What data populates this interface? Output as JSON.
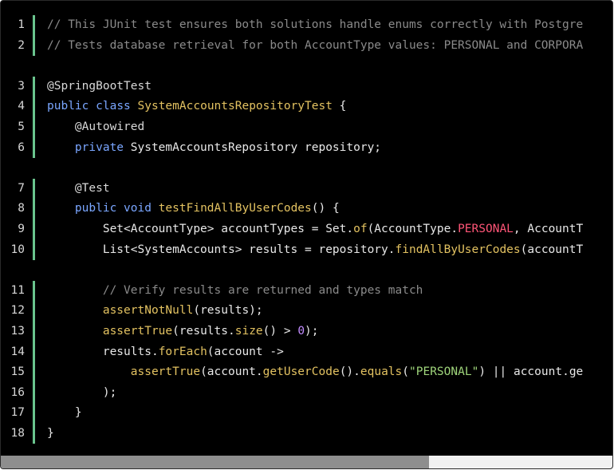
{
  "code_lines": [
    {
      "n": "1",
      "tokens": [
        [
          "com",
          "// This JUnit test ensures both solutions handle enums correctly with Postgre"
        ]
      ]
    },
    {
      "n": "2",
      "tokens": [
        [
          "com",
          "// Tests database retrieval for both AccountType values: PERSONAL and CORPORA"
        ]
      ]
    },
    {
      "n": "3",
      "tokens": [
        [
          "ann",
          "@SpringBootTest"
        ]
      ]
    },
    {
      "n": "4",
      "tokens": [
        [
          "kw",
          "public"
        ],
        [
          "",
          " "
        ],
        [
          "kw",
          "class"
        ],
        [
          "",
          " "
        ],
        [
          "cls",
          "SystemAccountsRepositoryTest"
        ],
        [
          "",
          " {"
        ]
      ]
    },
    {
      "n": "5",
      "tokens": [
        [
          "",
          "    "
        ],
        [
          "ann",
          "@Autowired"
        ]
      ]
    },
    {
      "n": "6",
      "tokens": [
        [
          "",
          "    "
        ],
        [
          "kw",
          "private"
        ],
        [
          "",
          " SystemAccountsRepository repository;"
        ]
      ]
    },
    {
      "n": "7",
      "tokens": [
        [
          "",
          "    "
        ],
        [
          "ann",
          "@Test"
        ]
      ]
    },
    {
      "n": "8",
      "tokens": [
        [
          "",
          "    "
        ],
        [
          "kw",
          "public"
        ],
        [
          "",
          " "
        ],
        [
          "kw",
          "void"
        ],
        [
          "",
          " "
        ],
        [
          "fn",
          "testFindAllByUserCodes"
        ],
        [
          "",
          "() {"
        ]
      ]
    },
    {
      "n": "9",
      "tokens": [
        [
          "",
          "        Set<AccountType> accountTypes = Set."
        ],
        [
          "fn",
          "of"
        ],
        [
          "",
          "(AccountType."
        ],
        [
          "enum",
          "PERSONAL"
        ],
        [
          "",
          ", AccountT"
        ]
      ]
    },
    {
      "n": "10",
      "tokens": [
        [
          "",
          "        List<SystemAccounts> results = repository."
        ],
        [
          "fn",
          "findAllByUserCodes"
        ],
        [
          "",
          "(accountT"
        ]
      ]
    },
    {
      "n": "11",
      "tokens": [
        [
          "",
          "        "
        ],
        [
          "com",
          "// Verify results are returned and types match"
        ]
      ]
    },
    {
      "n": "12",
      "tokens": [
        [
          "",
          "        "
        ],
        [
          "fn",
          "assertNotNull"
        ],
        [
          "",
          "(results);"
        ]
      ]
    },
    {
      "n": "13",
      "tokens": [
        [
          "",
          "        "
        ],
        [
          "fn",
          "assertTrue"
        ],
        [
          "",
          "(results."
        ],
        [
          "fn",
          "size"
        ],
        [
          "",
          "() > "
        ],
        [
          "num",
          "0"
        ],
        [
          "",
          ");"
        ]
      ]
    },
    {
      "n": "14",
      "tokens": [
        [
          "",
          "        results."
        ],
        [
          "fn",
          "forEach"
        ],
        [
          "",
          "(account ->"
        ]
      ]
    },
    {
      "n": "15",
      "tokens": [
        [
          "",
          "            "
        ],
        [
          "fn",
          "assertTrue"
        ],
        [
          "",
          "(account."
        ],
        [
          "fn",
          "getUserCode"
        ],
        [
          "",
          "()."
        ],
        [
          "fn",
          "equals"
        ],
        [
          "",
          "("
        ],
        [
          "str",
          "\"PERSONAL\""
        ],
        [
          "",
          ") || account.ge"
        ]
      ]
    },
    {
      "n": "16",
      "tokens": [
        [
          "",
          "        );"
        ]
      ]
    },
    {
      "n": "17",
      "tokens": [
        [
          "",
          "    }"
        ]
      ]
    },
    {
      "n": "18",
      "tokens": [
        [
          "",
          "}"
        ]
      ]
    }
  ],
  "blank_after_lines": [
    "2",
    "6",
    "10"
  ],
  "horizontal_scroll": {
    "position_fraction": 0.0,
    "visible_fraction": 0.7
  }
}
